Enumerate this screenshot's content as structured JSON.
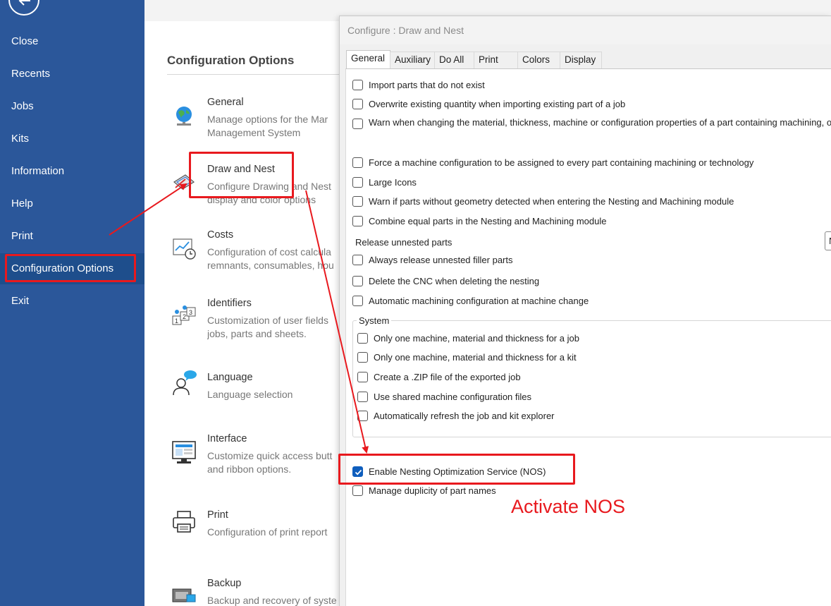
{
  "sidebar": {
    "items": [
      {
        "label": "Close"
      },
      {
        "label": "Recents"
      },
      {
        "label": "Jobs"
      },
      {
        "label": "Kits"
      },
      {
        "label": "Information"
      },
      {
        "label": "Help"
      },
      {
        "label": "Print"
      },
      {
        "label": "Configuration Options",
        "active": true
      },
      {
        "label": "Exit"
      }
    ]
  },
  "options_panel": {
    "title": "Configuration Options",
    "items": [
      {
        "title": "General",
        "desc1": "Manage options for the Mar",
        "desc2": "Management System",
        "icon": "globe-icon"
      },
      {
        "title": "Draw and Nest",
        "desc1": "Configure Drawing and Nest",
        "desc2": "display and color options",
        "icon": "draw-nest-icon"
      },
      {
        "title": "Costs",
        "desc1": "Configuration of cost calcula",
        "desc2": "remnants, consumables, hou",
        "icon": "cost-chart-icon"
      },
      {
        "title": "Identifiers",
        "desc1": "Customization of user fields",
        "desc2": "jobs, parts and sheets.",
        "icon": "identifiers-icon"
      },
      {
        "title": "Language",
        "desc1": "Language selection",
        "desc2": "",
        "icon": "language-icon"
      },
      {
        "title": "Interface",
        "desc1": "Customize quick access butt",
        "desc2": "and ribbon options.",
        "icon": "monitor-icon"
      },
      {
        "title": "Print",
        "desc1": "Configuration of print report",
        "desc2": "",
        "icon": "printer-icon"
      },
      {
        "title": "Backup",
        "desc1": "Backup and recovery of syste",
        "desc2": "",
        "icon": "backup-icon"
      }
    ]
  },
  "dialog": {
    "title": "Configure : Draw and Nest",
    "tabs": [
      {
        "label": "General",
        "active": true
      },
      {
        "label": "Auxiliary"
      },
      {
        "label": "Do All"
      },
      {
        "label": "Print"
      },
      {
        "label": "Colors"
      },
      {
        "label": "Display"
      }
    ],
    "checkboxes": [
      {
        "label": "Import parts that do not exist",
        "checked": false
      },
      {
        "label": "Overwrite existing quantity when importing existing part of a job",
        "checked": false
      },
      {
        "label": "Warn when changing the material, thickness, machine or configuration properties of a part containing machining, or",
        "checked": false
      },
      {
        "label": "Force a machine configuration to be assigned to every part containing machining or technology",
        "checked": false
      },
      {
        "label": "Large Icons",
        "checked": false
      },
      {
        "label": "Warn if parts without geometry detected when entering the Nesting and Machining module",
        "checked": false
      },
      {
        "label": "Combine equal parts in the Nesting and Machining module",
        "checked": false
      },
      {
        "label": "Always release unnested filler parts",
        "checked": false
      },
      {
        "label": "Delete the CNC when deleting the nesting",
        "checked": false
      },
      {
        "label": "Automatic machining configuration at machine change",
        "checked": false
      }
    ],
    "release_label": "Release unnested parts",
    "release_value": "N",
    "system_group": {
      "title": "System",
      "checkboxes": [
        {
          "label": "Only one machine, material and thickness for a job",
          "checked": false
        },
        {
          "label": "Only one machine, material and thickness for a kit",
          "checked": false
        },
        {
          "label": "Create a .ZIP file of the exported job",
          "checked": false
        },
        {
          "label": "Use shared machine configuration files",
          "checked": false
        },
        {
          "label": "Automatically refresh the job and kit explorer",
          "checked": false
        }
      ]
    },
    "bottom_checkboxes": [
      {
        "label": "Enable Nesting Optimization Service (NOS)",
        "checked": true
      },
      {
        "label": "Manage duplicity of part names",
        "checked": false
      }
    ]
  },
  "annotation": {
    "text": "Activate NOS",
    "color": "#e8191e"
  },
  "colors": {
    "sidebar_bg": "#2b579a",
    "checkbox_checked": "#0f5ebd",
    "highlight": "#e8191e"
  }
}
